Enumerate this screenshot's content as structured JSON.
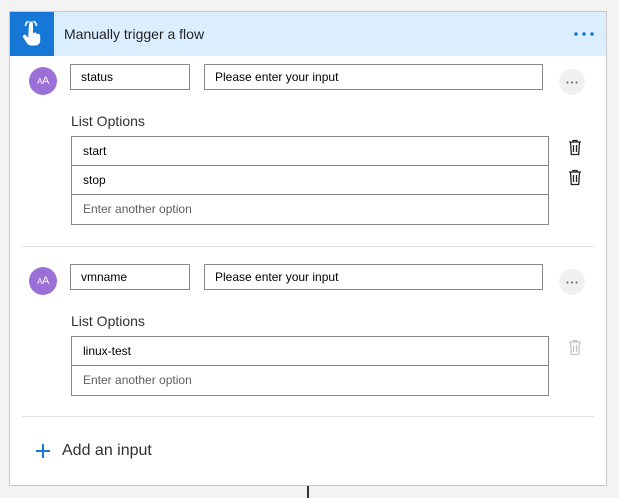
{
  "header": {
    "title": "Manually trigger a flow"
  },
  "inputs": [
    {
      "avatar_text": "AA",
      "name": "status",
      "placeholder": "Please enter your input",
      "options_label": "List Options",
      "options": [
        "start",
        "stop"
      ],
      "new_option_placeholder": "Enter another option"
    },
    {
      "avatar_text": "AA",
      "name": "vmname",
      "placeholder": "Please enter your input",
      "options_label": "List Options",
      "options": [
        "linux-test"
      ],
      "new_option_placeholder": "Enter another option"
    }
  ],
  "add_input_label": "Add an input",
  "colors": {
    "accent": "#1777d6",
    "header_bg": "#dbeeff",
    "avatar": "#9a6fd6"
  },
  "icons": {
    "trigger": "hand-tap-icon",
    "menu": "more-horizontal-icon",
    "delete": "trash-icon",
    "add": "plus-icon"
  }
}
